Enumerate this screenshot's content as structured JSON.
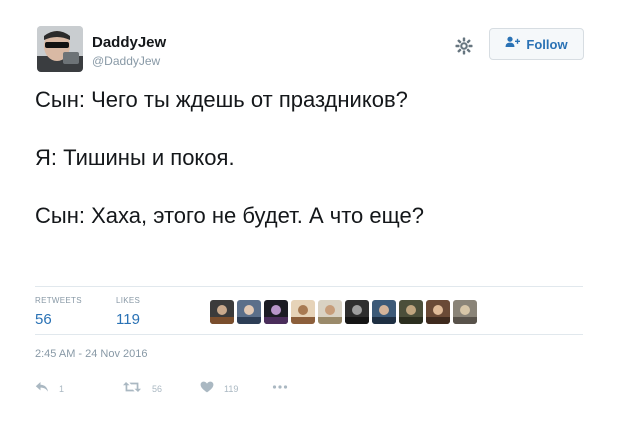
{
  "user": {
    "name": "DaddyJew",
    "handle": "@DaddyJew"
  },
  "header": {
    "follow_label": "Follow",
    "settings_icon": "gear-icon",
    "follow_icon": "add-user-icon"
  },
  "tweet": {
    "lines": [
      "Сын: Чего ты ждешь от праздников?",
      "Я: Тишины и покоя.",
      "Сын: Хаха, этого не будет. А что еще?"
    ]
  },
  "stats": {
    "retweets_label": "RETWEETS",
    "retweets_count": "56",
    "likes_label": "LIKES",
    "likes_count": "119"
  },
  "likers_avatar_count": 10,
  "timestamp": "2:45 AM - 24 Nov 2016",
  "actions": {
    "reply_count": "1",
    "retweet_count": "56",
    "like_count": "119",
    "more_icon": "more-icon"
  },
  "colors": {
    "link_blue": "#2a72b5",
    "muted_gray": "#8899a6",
    "icon_gray": "#aab8c2",
    "divider": "#e1e8ed"
  }
}
